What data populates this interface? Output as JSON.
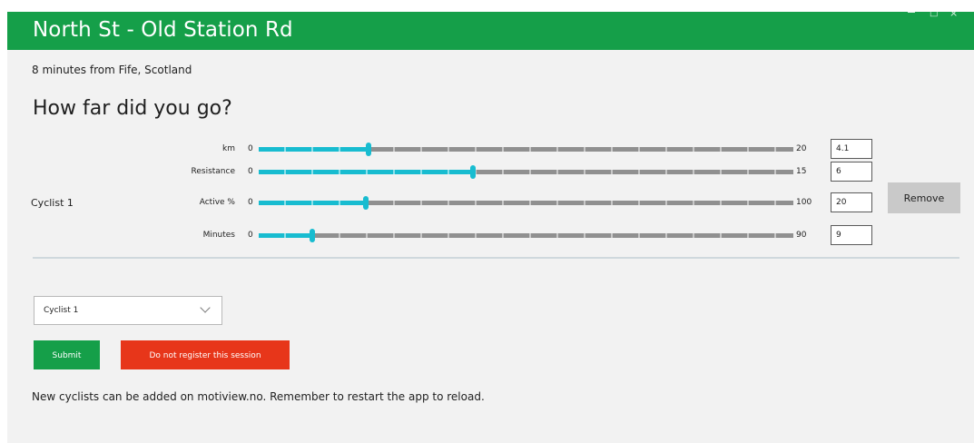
{
  "window": {
    "title": "North St - Old Station Rd",
    "controls": {
      "maximize_glyph": "□",
      "close_glyph": "×"
    }
  },
  "session": {
    "subtitle": "8 minutes from Fife, Scotland",
    "heading": "How far did you go?"
  },
  "cyclist": {
    "label": "Cyclist 1",
    "remove_label": "Remove",
    "metrics": [
      {
        "label": "km",
        "min": "0",
        "max": "20",
        "value": "4.1",
        "fraction": 0.205
      },
      {
        "label": "Resistance",
        "min": "0",
        "max": "15",
        "value": "6",
        "fraction": 0.4
      },
      {
        "label": "Active %",
        "min": "0",
        "max": "100",
        "value": "20",
        "fraction": 0.2
      },
      {
        "label": "Minutes",
        "min": "0",
        "max": "90",
        "value": "9",
        "fraction": 0.1
      }
    ]
  },
  "form": {
    "cyclist_select": {
      "value": "Cyclist 1"
    },
    "submit_label": "Submit",
    "decline_label": "Do not register this session",
    "footnote": "New cyclists can be added on motiview.no. Remember to restart the app to reload."
  },
  "colors": {
    "brand_green": "#159f49",
    "slider_accent": "#18bcd0",
    "danger_red": "#e7361a",
    "page_background": "#f2f2f2"
  }
}
